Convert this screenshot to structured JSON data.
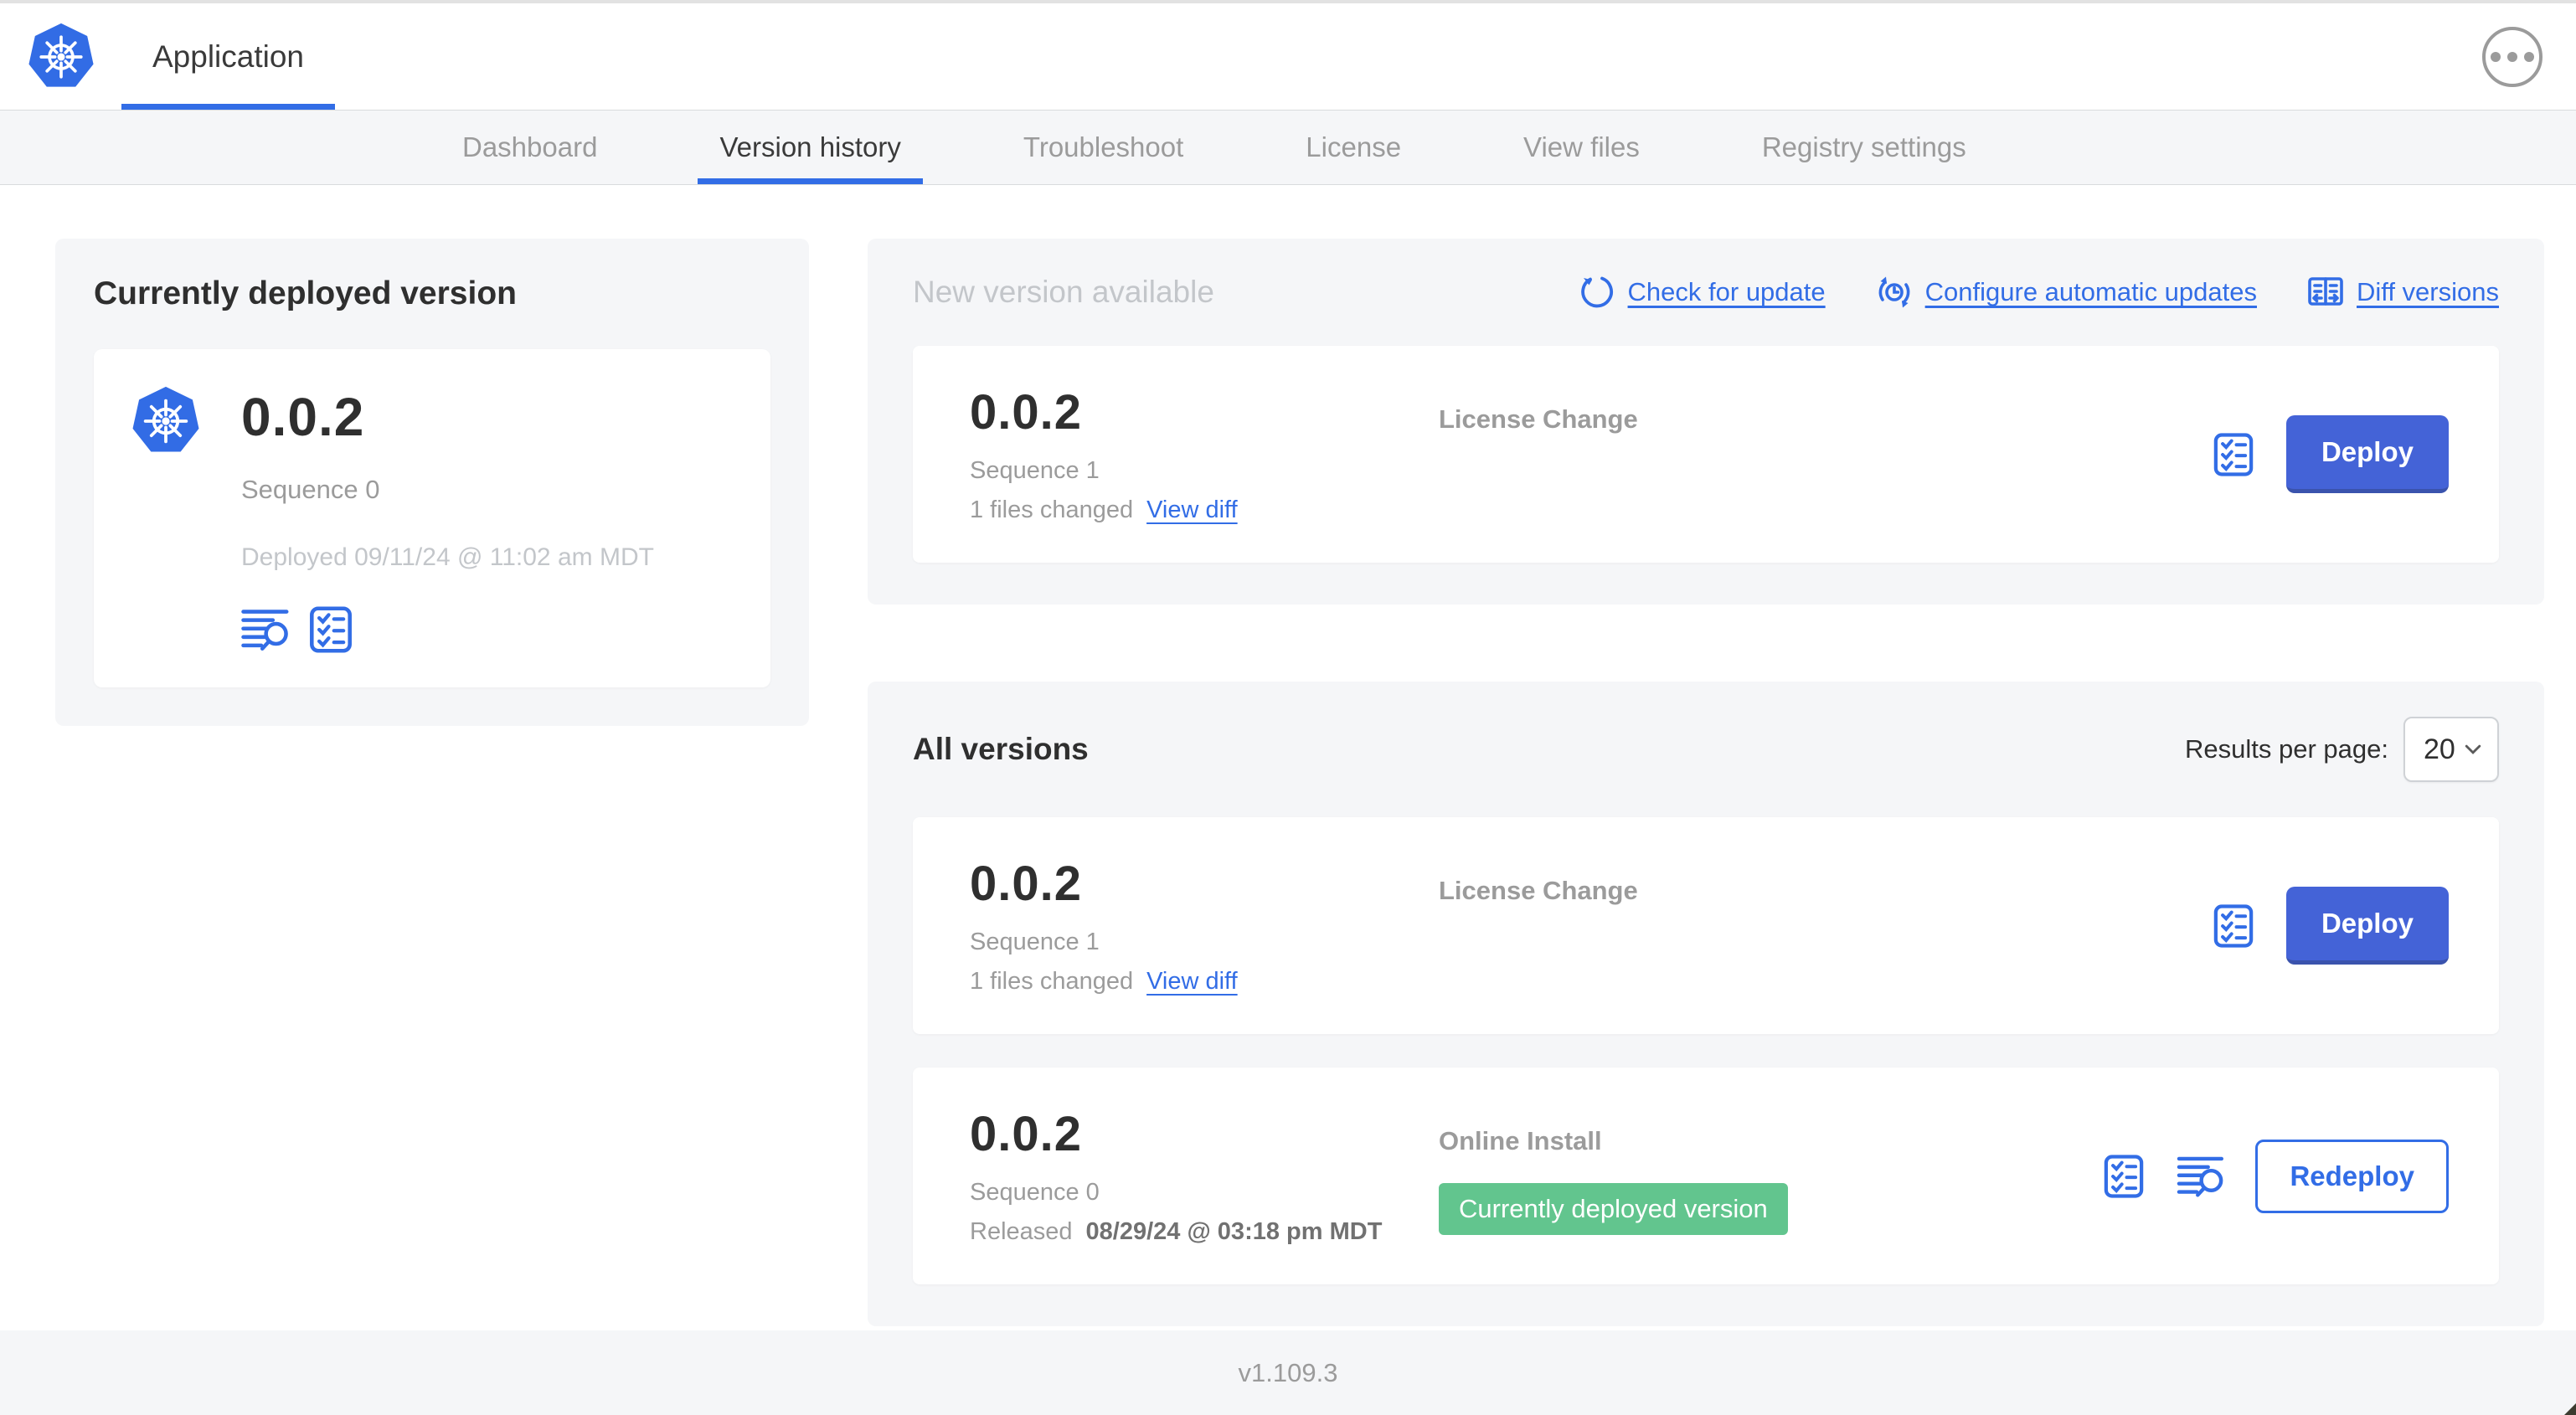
{
  "header": {
    "app_tab": "Application"
  },
  "nav": {
    "tabs": [
      {
        "label": "Dashboard"
      },
      {
        "label": "Version history"
      },
      {
        "label": "Troubleshoot"
      },
      {
        "label": "License"
      },
      {
        "label": "View files"
      },
      {
        "label": "Registry settings"
      }
    ],
    "active": "Version history"
  },
  "currently_deployed": {
    "title": "Currently deployed version",
    "version": "0.0.2",
    "sequence": "Sequence 0",
    "deployed": "Deployed 09/11/24 @ 11:02 am MDT"
  },
  "new_version": {
    "title": "New version available",
    "actions": [
      {
        "label": "Check for update",
        "icon": "refresh-icon"
      },
      {
        "label": "Configure automatic updates",
        "icon": "auto-update-icon"
      },
      {
        "label": "Diff versions",
        "icon": "diff-icon"
      }
    ],
    "row": {
      "version": "0.0.2",
      "sequence": "Sequence 1",
      "files_changed": "1 files changed",
      "view_diff": "View diff",
      "source": "License Change",
      "action": "Deploy"
    }
  },
  "all_versions": {
    "title": "All versions",
    "results_per_page_label": "Results per page:",
    "results_per_page_value": "20",
    "rows": [
      {
        "version": "0.0.2",
        "sequence": "Sequence 1",
        "files_changed": "1 files changed",
        "view_diff": "View diff",
        "source": "License Change",
        "action": "Deploy"
      },
      {
        "version": "0.0.2",
        "sequence": "Sequence 0",
        "released_prefix": "Released",
        "released_date": "08/29/24 @ 03:18 pm MDT",
        "source": "Online Install",
        "badge": "Currently deployed version",
        "action": "Redeploy"
      }
    ]
  },
  "footer": {
    "version": "v1.109.3"
  },
  "colors": {
    "accent_blue": "#326de6",
    "button_blue": "#4463d7",
    "badge_green": "#62c58e",
    "panel_gray": "#f5f6f8",
    "text_dark": "#323232",
    "text_gray": "#9b9b9b",
    "text_muted": "#c3c6ca"
  }
}
